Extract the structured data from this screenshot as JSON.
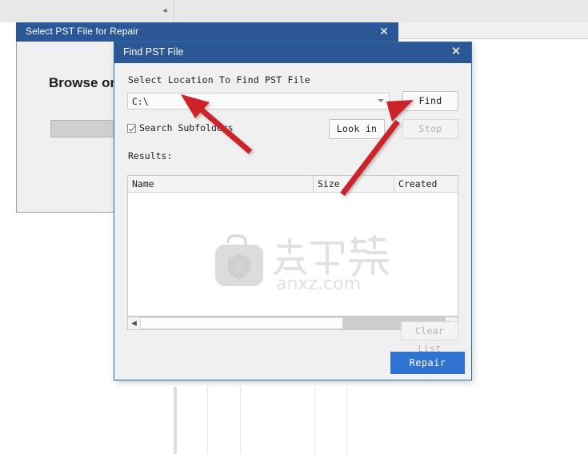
{
  "background_app": {
    "toolbar_arrow_icon": "caret-left-icon"
  },
  "back_dialog": {
    "title": "Select PST File for Repair",
    "close_label": "✕",
    "heading": "Browse or Find",
    "field_value": ""
  },
  "find_dialog": {
    "title": "Find PST File",
    "close_label": "✕",
    "location_label": "Select Location To Find PST File",
    "location_value": "C:\\",
    "dropdown_icon": "chevron-down-icon",
    "find_button": "Find",
    "lookin_button": "Look in",
    "stop_button": "Stop",
    "search_subfolders_label": "Search Subfolders",
    "search_subfolders_checked": true,
    "results_label": "Results:",
    "columns": [
      "Name",
      "Size",
      "Created"
    ],
    "rows": [],
    "clear_list_button": "Clear List",
    "repair_button": "Repair",
    "scrollbar": {
      "left_arrow_icon": "caret-left-icon",
      "right_arrow_icon": "caret-right-icon"
    }
  },
  "watermark": {
    "text": "anxz.com",
    "cn_text": "安下载",
    "icon": "shield-bag-icon"
  },
  "annotations": {
    "arrow_1_target": "location-combobox",
    "arrow_2_target": "find-button",
    "color": "#cc2229"
  },
  "colors": {
    "titlebar": "#2b5797",
    "dialog_bg": "#f0f0f0",
    "accent_button": "#2f72d0",
    "dialog_border": "#2b6ca3"
  }
}
